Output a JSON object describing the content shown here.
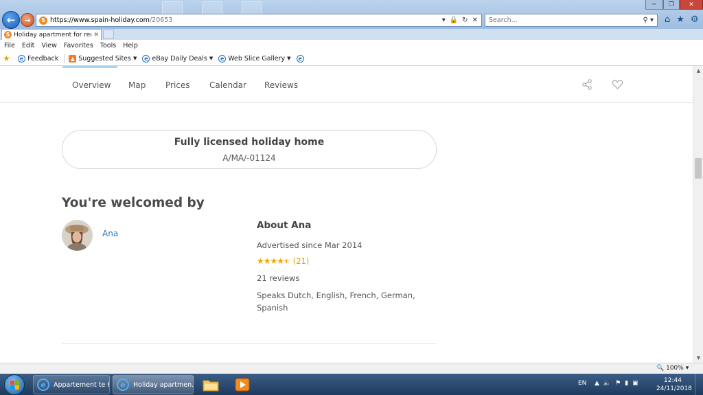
{
  "browser": {
    "url_host": "https://www.spain-holiday.com",
    "url_path": "/20653",
    "search_placeholder": "Search...",
    "tab_title": "Holiday apartment for rent ...",
    "menu": [
      "File",
      "Edit",
      "View",
      "Favorites",
      "Tools",
      "Help"
    ],
    "favorites": [
      {
        "label": "Feedback",
        "icon": "ie-page-icon",
        "dropdown": false
      },
      {
        "label": "Suggested Sites",
        "icon": "suggested-sites-icon",
        "dropdown": true
      },
      {
        "label": "eBay Daily Deals",
        "icon": "ie-page-icon",
        "dropdown": true
      },
      {
        "label": "Web Slice Gallery",
        "icon": "ie-page-icon",
        "dropdown": true
      }
    ],
    "zoom": "100%"
  },
  "page": {
    "nav": [
      "Overview",
      "Map",
      "Prices",
      "Calendar",
      "Reviews"
    ],
    "license": {
      "title": "Fully licensed holiday home",
      "number": "A/MA/-01124"
    },
    "welcome_heading": "You're welcomed by",
    "host": {
      "name": "Ana",
      "about_title": "About Ana",
      "advertised_since": "Advertised since Mar 2014",
      "rating_count": "(21)",
      "rating_value": 4.5,
      "rating_max": 5,
      "reviews": "21 reviews",
      "languages": "Speaks Dutch, English, French, German, Spanish"
    }
  },
  "taskbar": {
    "tasks": [
      "Appartement te H...",
      "Holiday apartmen..."
    ],
    "language": "EN",
    "time": "12:44",
    "date": "24/11/2018"
  },
  "colors": {
    "link": "#2777b5",
    "star": "#f5a800",
    "nav_indicator": "#a9d3ee"
  }
}
